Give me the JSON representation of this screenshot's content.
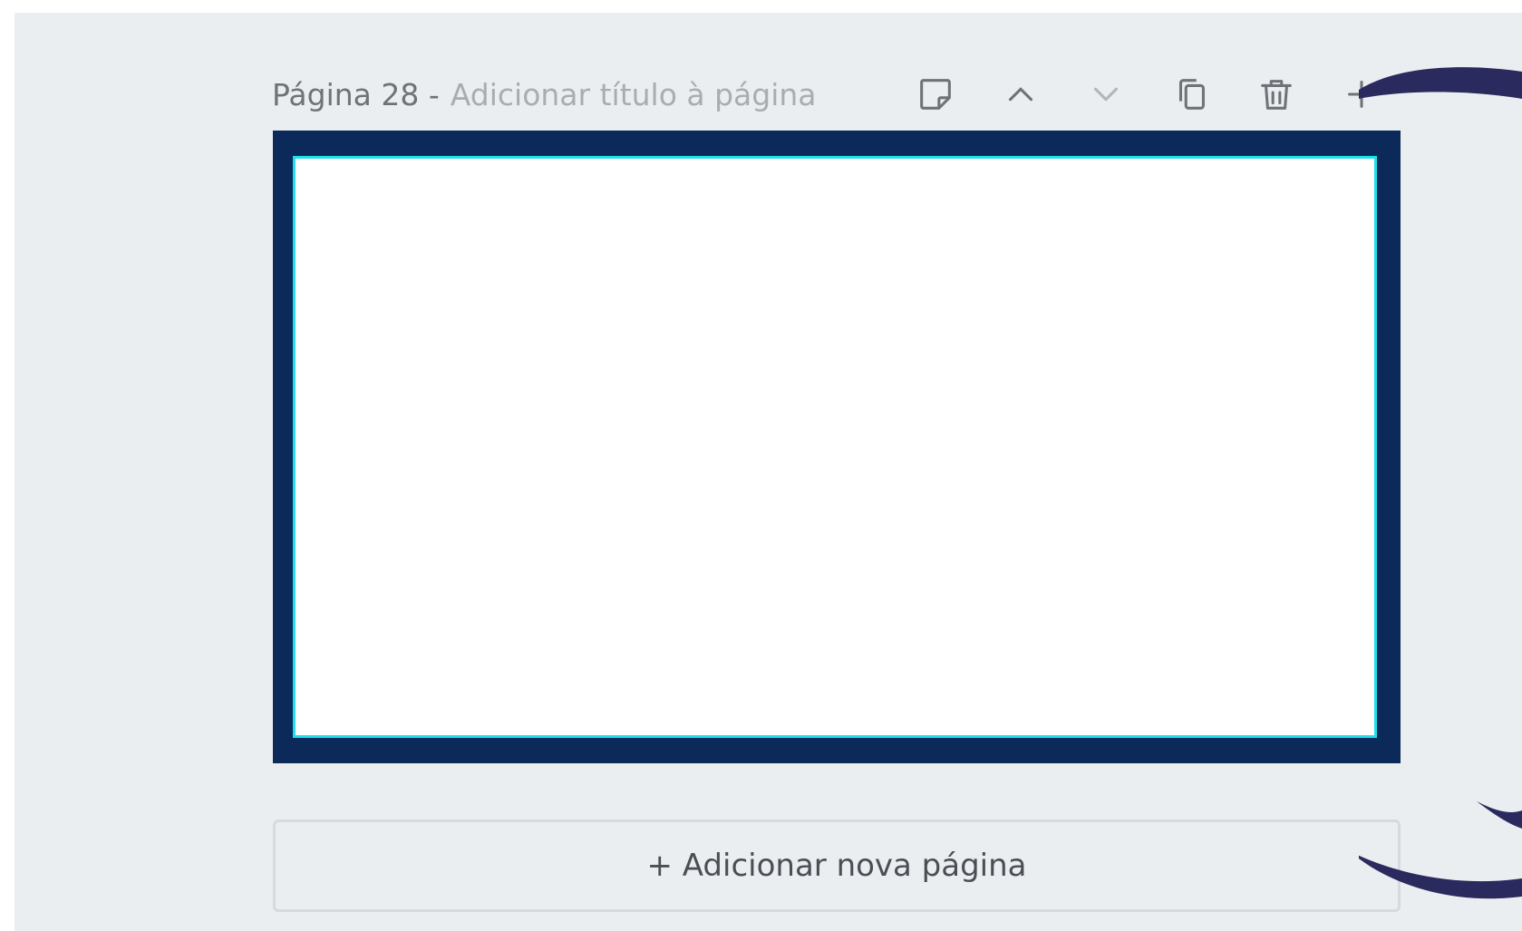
{
  "page": {
    "number_label": "Página 28 -",
    "title_placeholder": "Adicionar título à página"
  },
  "toolbar": {
    "buttons": [
      {
        "name": "notes",
        "icon": "sticky-note-icon",
        "enabled": true
      },
      {
        "name": "move-up",
        "icon": "chevron-up-icon",
        "enabled": true
      },
      {
        "name": "move-down",
        "icon": "chevron-down-icon",
        "enabled": false
      },
      {
        "name": "duplicate",
        "icon": "copy-icon",
        "enabled": true
      },
      {
        "name": "delete",
        "icon": "trash-icon",
        "enabled": true
      },
      {
        "name": "add",
        "icon": "plus-icon",
        "enabled": true
      }
    ]
  },
  "canvas": {
    "frame_color": "#0b2a5a",
    "selection_color": "#1ee0ea",
    "background": "#ffffff"
  },
  "add_page": {
    "label": "+ Adicionar nova página"
  },
  "colors": {
    "workspace_bg": "#ebeef1",
    "icon": "#6f7378",
    "decoration": "#2a2a5e"
  }
}
